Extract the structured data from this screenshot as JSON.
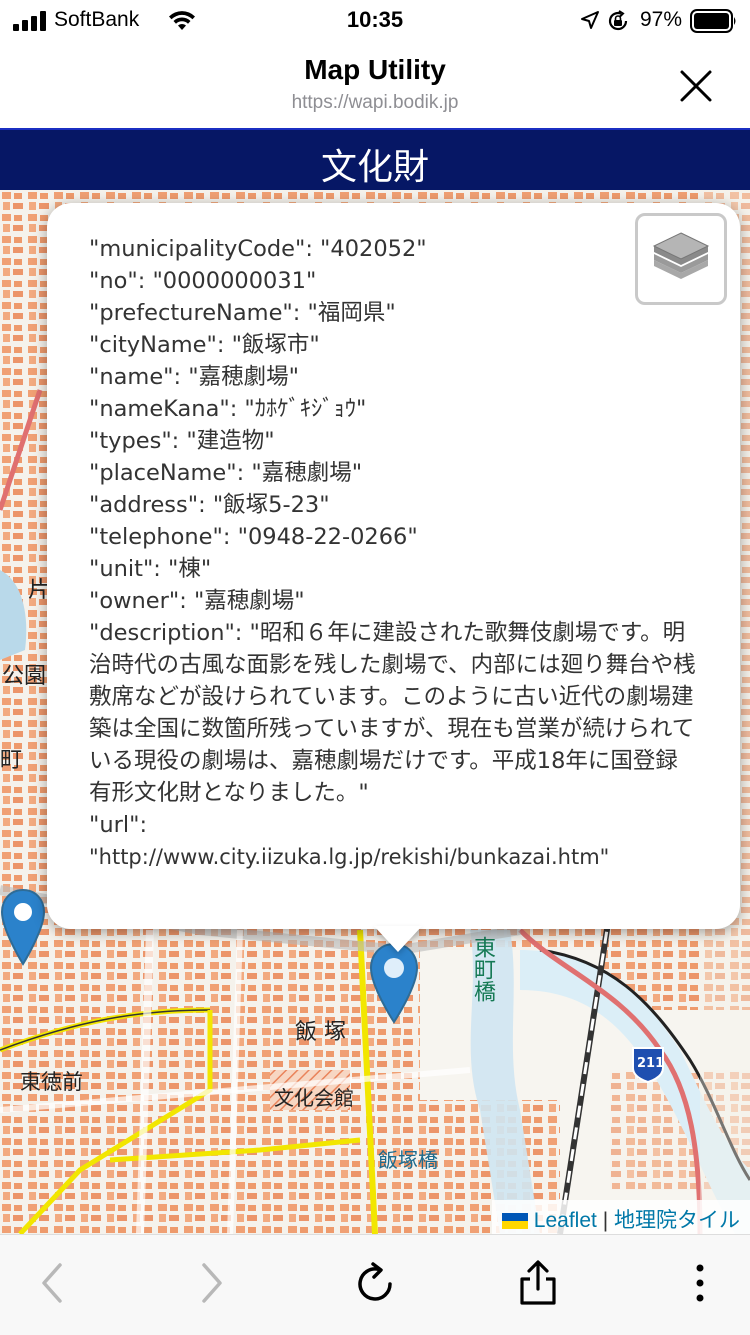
{
  "status_bar": {
    "carrier": "SoftBank",
    "time": "10:35",
    "battery": "97%"
  },
  "header": {
    "title": "Map Utility",
    "url": "https://wapi.bodik.jp"
  },
  "banner": {
    "title": "文化財"
  },
  "popup": {
    "municipalityCode": "\"municipalityCode\": \"402052\"",
    "no": "\"no\": \"0000000031\"",
    "prefectureName": "\"prefectureName\": \"福岡県\"",
    "cityName": "\"cityName\": \"飯塚市\"",
    "name": "\"name\": \"嘉穂劇場\"",
    "nameKana": "\"nameKana\": \"ｶﾎｹﾞｷｼﾞｮｳ\"",
    "types": "\"types\": \"建造物\"",
    "placeName": "\"placeName\": \"嘉穂劇場\"",
    "address": "\"address\": \"飯塚5-23\"",
    "telephone": "\"telephone\": \"0948-22-0266\"",
    "unit": "\"unit\": \"棟\"",
    "owner": "\"owner\": \"嘉穂劇場\"",
    "description": "\"description\": \"昭和６年に建設された歌舞伎劇場です。明治時代の古風な面影を残した劇場で、内部には廻り舞台や桟敷席などが設けられています。このように古い近代の劇場建築は全国に数箇所残っていますが、現在も営業が続けられている現役の劇場は、嘉穂劇場だけです。平成18年に国登録有形文化財となりました。\"",
    "url_key": "\"url\":",
    "url_value": "\"http://www.city.iizuka.lg.jp/rekishi/bunkazai.htm\""
  },
  "map": {
    "labels": {
      "iizuka": "飯 塚",
      "bunka_kaikan": "文化会館",
      "higashi_tokuzen": "東徳前",
      "iizuka_bashi": "飯塚橋",
      "higashimachi_bashi": "東町橋",
      "kouen": "公園",
      "kata": "片",
      "machi": "町",
      "route": "211"
    },
    "attribution": {
      "leaflet": "Leaflet",
      "separator": "|",
      "tiles": "地理院タイル"
    }
  },
  "colors": {
    "banner_bg": "#061765",
    "marker": "#2b82cb",
    "attribution_link": "#0078a8"
  },
  "icons": [
    "signal-icon",
    "wifi-icon",
    "location-icon",
    "rotation-lock-icon",
    "battery-icon",
    "close-icon",
    "layers-icon",
    "map-marker-icon",
    "back-icon",
    "forward-icon",
    "reload-icon",
    "share-icon",
    "more-icon"
  ]
}
